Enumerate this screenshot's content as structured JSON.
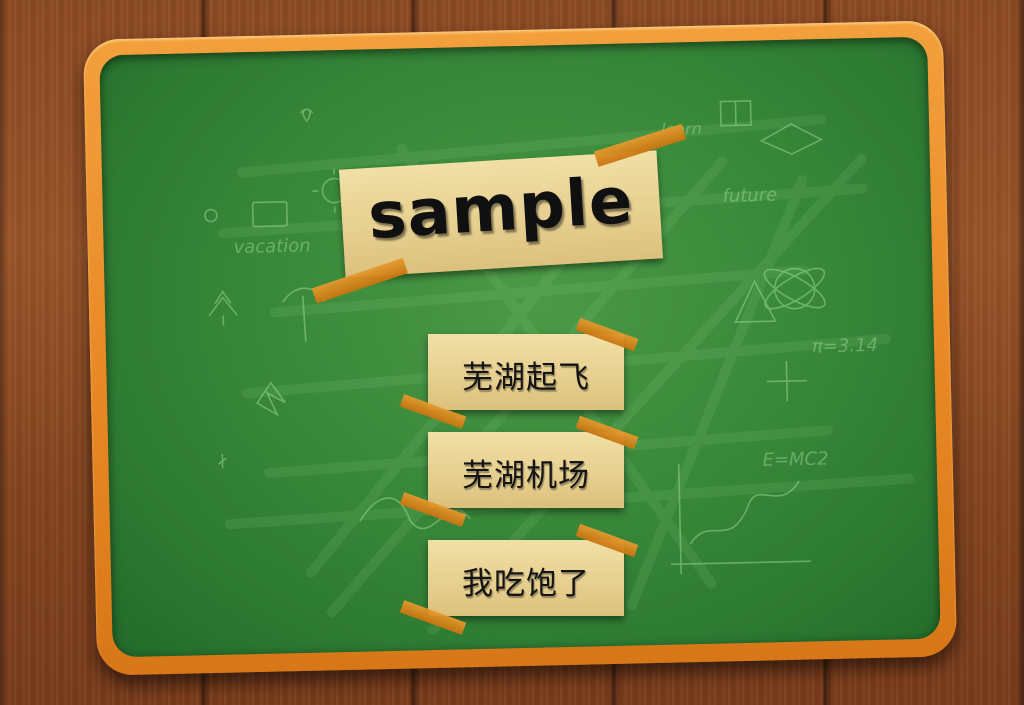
{
  "title": "sample",
  "menu": {
    "items": [
      {
        "label": "芜湖起飞"
      },
      {
        "label": "芜湖机场"
      },
      {
        "label": "我吃饱了"
      }
    ]
  },
  "chalk_doodles": {
    "words": [
      "vacation",
      "future",
      "learn"
    ],
    "formulas": [
      "π=3.14",
      "E=MC2"
    ]
  },
  "colors": {
    "wood": "#8c4a23",
    "frame": "#e88825",
    "board": "#3a8a3b",
    "paper": "#e7d090",
    "tape": "#d98418",
    "text": "#141414"
  }
}
